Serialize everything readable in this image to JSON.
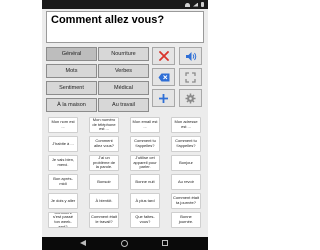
{
  "message": {
    "text": "Comment allez vous?"
  },
  "categories": [
    {
      "label": "Général",
      "active": true
    },
    {
      "label": "Nourriture",
      "active": false
    },
    {
      "label": "Mots",
      "active": false
    },
    {
      "label": "Verbes",
      "active": false
    },
    {
      "label": "Sentiment",
      "active": false
    },
    {
      "label": "Médical",
      "active": false
    },
    {
      "label": "À la maison",
      "active": false
    },
    {
      "label": "Au travail",
      "active": false
    }
  ],
  "tools": [
    {
      "name": "clear-icon",
      "color": "#d9342b"
    },
    {
      "name": "speaker-icon",
      "color": "#2f6fd6"
    },
    {
      "name": "backspace-icon",
      "color": "#2f6fd6"
    },
    {
      "name": "fullscreen-icon",
      "color": "#8a8a8a"
    },
    {
      "name": "add-icon",
      "color": "#2f6fd6"
    },
    {
      "name": "settings-icon",
      "color": "#8a8a8a"
    }
  ],
  "phrases": [
    "Mon nom est ...",
    "Mon numéro de téléphone est ...",
    "Mon email est ...",
    "Mon adresse est ...",
    "J'habite à ...",
    "Comment allez vous?",
    "Comment tu t'appelles?",
    "Comment tu t'appelles?",
    "Je vais bien, merci.",
    "J'ai un problème de la parole.",
    "J'utilise cet appareil pour parler.",
    "Bonjour",
    "Bon après-midi",
    "Bonsoir",
    "Bonne nuit",
    "Au revoir",
    "Je dois y aller",
    "À bientôt.",
    "À plus tard",
    "Comment était ta journée?",
    "Comment s'est passé ton week-end?",
    "Comment était le travail?",
    "Que faites-vous?",
    "Bonne journée."
  ]
}
